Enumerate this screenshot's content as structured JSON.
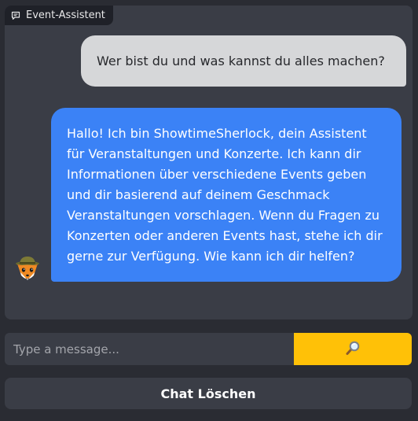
{
  "chat": {
    "label": "Event-Assistent",
    "label_icon": "chat-bubble-icon",
    "messages": [
      {
        "role": "user",
        "text": "Wer bist du und was kannst du alles machen?"
      },
      {
        "role": "bot",
        "text": "Hallo! Ich bin ShowtimeSherlock, dein Assistent für Veranstaltungen und Konzerte. Ich kann dir Informationen über verschiedene Events geben und dir basierend auf deinem Geschmack Veranstaltungen vorschlagen. Wenn du Fragen zu Konzerten oder anderen Events hast, stehe ich dir gerne zur Verfügung. Wie kann ich dir helfen?",
        "avatar": "fox-detective-avatar"
      }
    ]
  },
  "input": {
    "placeholder": "Type a message...",
    "value": "",
    "submit_icon": "magnifying-glass-icon"
  },
  "clear_button": {
    "label": "Chat Löschen"
  },
  "colors": {
    "background": "#2a2c33",
    "panel": "#3a3d46",
    "user_bubble": "#d6d7d9",
    "bot_bubble": "#3b82f6",
    "accent": "#ffc107"
  }
}
